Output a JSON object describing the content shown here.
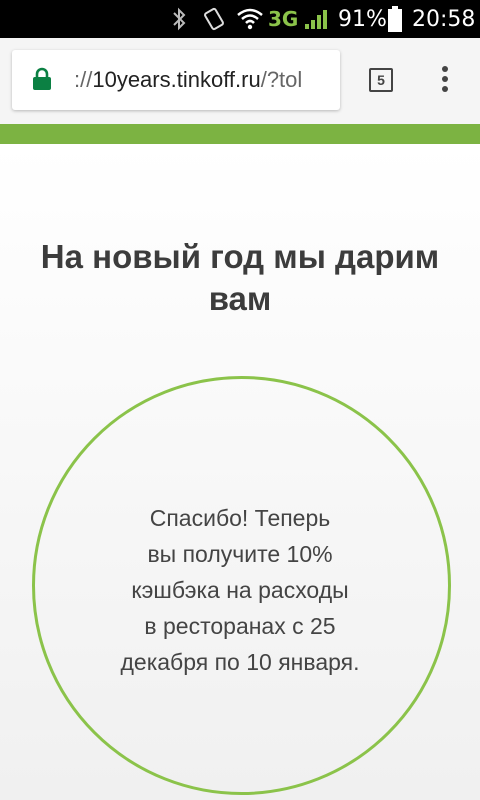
{
  "status_bar": {
    "network": "3G",
    "battery": "91%",
    "time": "20:58",
    "icons": [
      "bluetooth-icon",
      "rotate-icon",
      "wifi-icon",
      "signal-icon",
      "battery-icon"
    ]
  },
  "browser": {
    "url_prefix": "://",
    "url_host": "10years.tinkoff.ru",
    "url_rest": "/?tol",
    "tab_count": "5",
    "icons": [
      "lock-icon",
      "tab-switcher-icon",
      "overflow-menu-icon"
    ]
  },
  "colors": {
    "accent_green": "#7cb342",
    "circle_green": "#8bc34a",
    "lock_green": "#0b8043"
  },
  "page": {
    "heading": "На новый год мы дарим вам",
    "message_lines": [
      "Спасибо! Теперь",
      "вы получите 10%",
      "кэшбэка на расходы",
      "в ресторанах с 25",
      "декабря по 10 января."
    ]
  }
}
